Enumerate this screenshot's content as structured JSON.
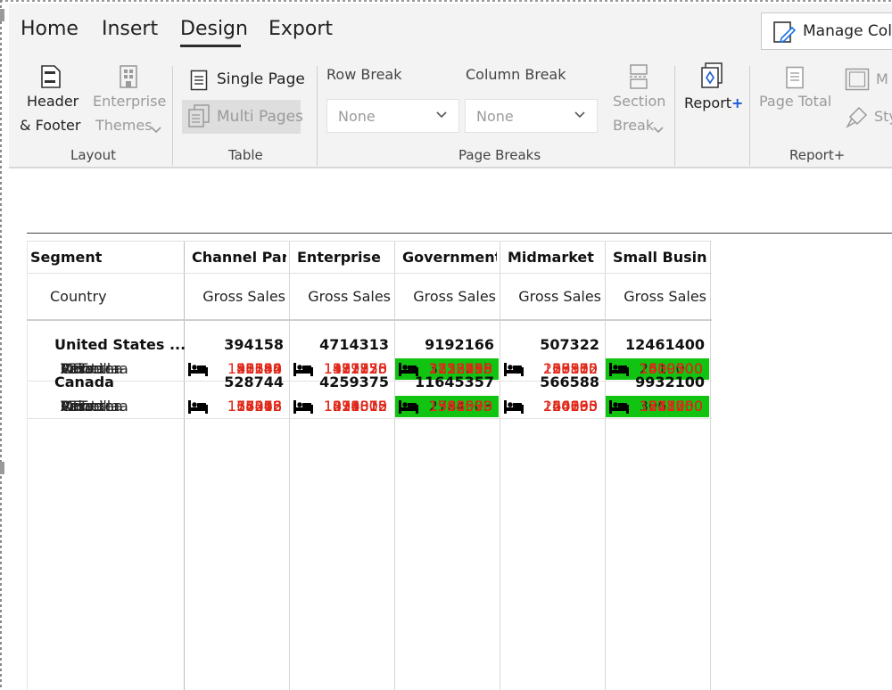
{
  "tabs": [
    "Home",
    "Insert",
    "Design",
    "Export"
  ],
  "active_tab": "Design",
  "manage_button": "Manage Colum",
  "layout_group": {
    "label": "Layout",
    "header_footer": [
      "Header",
      "& Footer"
    ],
    "enterprise_themes": [
      "Enterprise",
      "Themes"
    ]
  },
  "table_group": {
    "label": "Table",
    "single_page": "Single Page",
    "multi_pages": "Multi Pages"
  },
  "page_breaks_group": {
    "label": "Page Breaks",
    "row_break": "Row Break",
    "column_break": "Column Break",
    "row_value": "None",
    "column_value": "None",
    "section_break": [
      "Section",
      "Break"
    ]
  },
  "report_group": {
    "label": "Report+",
    "report_plus": "Report",
    "plus": "+",
    "page_total": "Page Total",
    "more1": "M",
    "more2": "Sty"
  },
  "table": {
    "segment_header": "Segment",
    "country_header": "Country",
    "columns": [
      "Channel Partners",
      "Enterprise",
      "Government",
      "Midmarket",
      "Small Business"
    ],
    "measure": "Gross Sales",
    "groups": [
      {
        "name": "United States ...",
        "totals": [
          "394158",
          "4714313",
          "9192166",
          "507322",
          "12461400"
        ],
        "rows": [
          {
            "label": "Paseo",
            "values": [
              "91650",
              "922125",
              "3122255",
              "237510",
              "3092700"
            ],
            "green": [
              false,
              false,
              true,
              false,
              true
            ]
          },
          {
            "label": "VTT",
            "values": [
              "45144",
              "389250",
              "2123498",
              "55800",
              "3409200"
            ],
            "green": [
              false,
              false,
              false,
              false,
              true
            ]
          },
          {
            "label": "Velo",
            "values": [
              "28548",
              "1391750",
              "723198",
              "20175",
              "2610000"
            ],
            "green": [
              false,
              false,
              false,
              false,
              true
            ]
          },
          {
            "label": "Montana",
            "values": [
              "46380",
              "1111375",
              "1256739",
              "19380",
              "1439700"
            ],
            "green": [
              false,
              false,
              false,
              false,
              false
            ]
          },
          {
            "label": "Amarilla",
            "values": [
              "132144",
              "427875",
              "1152510",
              "105502",
              "1309500"
            ],
            "green": [
              false,
              false,
              false,
              false,
              false
            ]
          },
          {
            "label": "Carretera",
            "values": [
              "50292",
              "471938",
              "813966",
              "68955",
              "600300"
            ],
            "green": [
              false,
              false,
              false,
              false,
              false
            ]
          }
        ]
      },
      {
        "name": "Canada",
        "totals": [
          "528744",
          "4259375",
          "11645357",
          "566588",
          "9932100"
        ],
        "rows": [
          {
            "label": "Paseo",
            "values": [
              "177492",
              "1011875",
              "4256485",
              "220260",
              "2506500"
            ],
            "green": [
              false,
              false,
              true,
              false,
              true
            ]
          },
          {
            "label": "VTT",
            "values": [
              "64242",
              "1224375",
              "708761",
              "66135",
              "3063000"
            ],
            "green": [
              false,
              false,
              false,
              false,
              true
            ]
          },
          {
            "label": "Amarilla",
            "values": [
              "75378",
              "413000",
              "2784503",
              "50603",
              "841200"
            ],
            "green": [
              false,
              false,
              true,
              false,
              false
            ]
          },
          {
            "label": "Velo",
            "values": [
              "36348",
              "839000",
              "1541599",
              "24690",
              "1218750"
            ],
            "green": [
              false,
              false,
              false,
              false,
              false
            ]
          },
          {
            "label": "Montana",
            "values": [
              "58068",
              "376313",
              "958079",
              "64005",
              "1525650"
            ],
            "green": [
              false,
              false,
              false,
              false,
              false
            ]
          },
          {
            "label": "Carretera",
            "values": [
              "117216",
              "394812",
              "1395930",
              "140895",
              "777000"
            ],
            "green": [
              false,
              false,
              false,
              false,
              false
            ]
          }
        ]
      }
    ],
    "highlight_color": "#11c411",
    "value_color": "#e0281a",
    "icon": "bed-icon"
  }
}
